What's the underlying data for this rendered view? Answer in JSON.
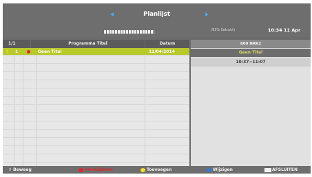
{
  "header": {
    "title": "Planlijst",
    "selected_info": "(93% Selcukt)",
    "clock": "10:34 11 Apr"
  },
  "table": {
    "columns": {
      "index": "1/1",
      "program": "Programma Titel",
      "date": "Datum"
    },
    "rows": [
      {
        "marker": "↕",
        "number": "1",
        "status_icon": "record-icon",
        "title": "Geen Titel",
        "date": "11/04/2014"
      }
    ]
  },
  "details": {
    "channel": "800 NRK2",
    "program_title": "Geen Titel",
    "time_range": "10:37~11:07"
  },
  "footer": {
    "move": "Beweeg",
    "delete": "Verwijderen",
    "add": "Toevoegen",
    "edit": "Wijzigen",
    "exit": "AFSLUITEN"
  },
  "colors": {
    "highlight_row": "#b8c92a",
    "red_key": "#e0262f",
    "yellow_key": "#f2e12a",
    "blue_key": "#2f7ad8",
    "arrow": "#4aa8e8"
  }
}
